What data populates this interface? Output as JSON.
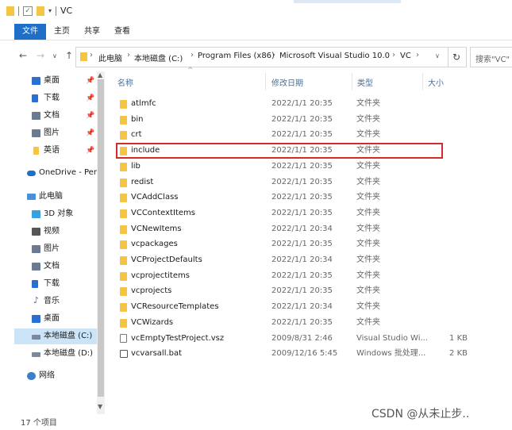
{
  "window": {
    "title": "VC"
  },
  "ribbon": {
    "tabs": [
      "文件",
      "主页",
      "共享",
      "查看"
    ]
  },
  "address": {
    "breadcrumbs": [
      "此电脑",
      "本地磁盘 (C:)",
      "Program Files (x86)",
      "Microsoft Visual Studio 10.0",
      "VC"
    ],
    "search_placeholder": "搜索\"VC\""
  },
  "nav": {
    "items": [
      {
        "label": "桌面",
        "icon": "desktop-icon",
        "color": "#2b6fd1",
        "pinned": true
      },
      {
        "label": "下载",
        "icon": "download-icon",
        "color": "#2b6fd1",
        "pinned": true
      },
      {
        "label": "文档",
        "icon": "document-icon",
        "color": "#6a7b90",
        "pinned": true
      },
      {
        "label": "图片",
        "icon": "picture-icon",
        "color": "#6a7b90",
        "pinned": true
      },
      {
        "label": "英语",
        "icon": "folder-icon",
        "color": "#f4c542",
        "pinned": true
      },
      {
        "label": "OneDrive - Perso",
        "icon": "cloud-icon",
        "color": "#1f6ec7",
        "pinned": false
      },
      {
        "label": "此电脑",
        "icon": "computer-icon",
        "color": "#4a90d9",
        "pinned": false
      },
      {
        "label": "3D 对象",
        "icon": "cube-icon",
        "color": "#3aa0e0",
        "pinned": false
      },
      {
        "label": "视频",
        "icon": "video-icon",
        "color": "#555555",
        "pinned": false
      },
      {
        "label": "图片",
        "icon": "picture-icon",
        "color": "#6a7b90",
        "pinned": false
      },
      {
        "label": "文档",
        "icon": "document-icon",
        "color": "#6a7b90",
        "pinned": false
      },
      {
        "label": "下载",
        "icon": "download-icon",
        "color": "#2b6fd1",
        "pinned": false
      },
      {
        "label": "音乐",
        "icon": "music-icon",
        "color": "#2b6fd1",
        "pinned": false
      },
      {
        "label": "桌面",
        "icon": "desktop-icon",
        "color": "#2b6fd1",
        "pinned": false
      },
      {
        "label": "本地磁盘 (C:)",
        "icon": "drive-icon",
        "color": "#7a8a9a",
        "pinned": false,
        "selected": true
      },
      {
        "label": "本地磁盘 (D:)",
        "icon": "drive-icon",
        "color": "#7a8a9a",
        "pinned": false
      },
      {
        "label": "网络",
        "icon": "network-icon",
        "color": "#3a7fc8",
        "pinned": false
      }
    ]
  },
  "columns": [
    "名称",
    "修改日期",
    "类型",
    "大小"
  ],
  "files": [
    {
      "name": "atlmfc",
      "date": "2022/1/1 20:35",
      "type": "文件夹",
      "size": "",
      "kind": "folder"
    },
    {
      "name": "bin",
      "date": "2022/1/1 20:35",
      "type": "文件夹",
      "size": "",
      "kind": "folder"
    },
    {
      "name": "crt",
      "date": "2022/1/1 20:35",
      "type": "文件夹",
      "size": "",
      "kind": "folder"
    },
    {
      "name": "include",
      "date": "2022/1/1 20:35",
      "type": "文件夹",
      "size": "",
      "kind": "folder",
      "highlighted": true
    },
    {
      "name": "lib",
      "date": "2022/1/1 20:35",
      "type": "文件夹",
      "size": "",
      "kind": "folder"
    },
    {
      "name": "redist",
      "date": "2022/1/1 20:35",
      "type": "文件夹",
      "size": "",
      "kind": "folder"
    },
    {
      "name": "VCAddClass",
      "date": "2022/1/1 20:35",
      "type": "文件夹",
      "size": "",
      "kind": "folder"
    },
    {
      "name": "VCContextItems",
      "date": "2022/1/1 20:35",
      "type": "文件夹",
      "size": "",
      "kind": "folder"
    },
    {
      "name": "VCNewItems",
      "date": "2022/1/1 20:34",
      "type": "文件夹",
      "size": "",
      "kind": "folder"
    },
    {
      "name": "vcpackages",
      "date": "2022/1/1 20:35",
      "type": "文件夹",
      "size": "",
      "kind": "folder"
    },
    {
      "name": "VCProjectDefaults",
      "date": "2022/1/1 20:34",
      "type": "文件夹",
      "size": "",
      "kind": "folder"
    },
    {
      "name": "vcprojectitems",
      "date": "2022/1/1 20:35",
      "type": "文件夹",
      "size": "",
      "kind": "folder"
    },
    {
      "name": "vcprojects",
      "date": "2022/1/1 20:35",
      "type": "文件夹",
      "size": "",
      "kind": "folder"
    },
    {
      "name": "VCResourceTemplates",
      "date": "2022/1/1 20:34",
      "type": "文件夹",
      "size": "",
      "kind": "folder"
    },
    {
      "name": "VCWizards",
      "date": "2022/1/1 20:35",
      "type": "文件夹",
      "size": "",
      "kind": "folder"
    },
    {
      "name": "vcEmptyTestProject.vsz",
      "date": "2009/8/31 2:46",
      "type": "Visual Studio Wi...",
      "size": "1 KB",
      "kind": "file"
    },
    {
      "name": "vcvarsall.bat",
      "date": "2009/12/16 5:45",
      "type": "Windows 批处理...",
      "size": "2 KB",
      "kind": "bat"
    }
  ],
  "status": {
    "item_count": "17 个项目"
  },
  "watermark": "CSDN @从未止步.."
}
